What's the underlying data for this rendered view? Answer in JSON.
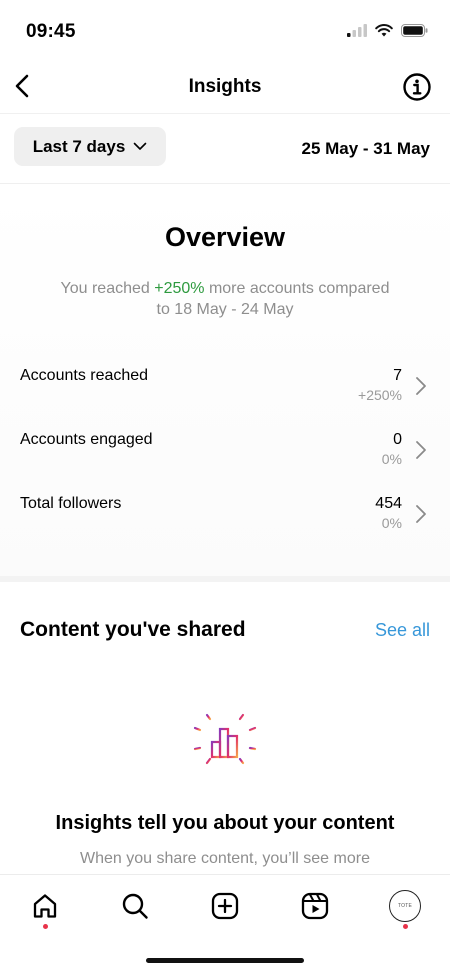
{
  "status_bar": {
    "time": "09:45"
  },
  "nav": {
    "title": "Insights"
  },
  "range": {
    "selector_label": "Last 7 days",
    "dates": "25 May - 31 May"
  },
  "overview": {
    "title": "Overview",
    "summary_prefix": "You reached ",
    "summary_highlight": "+250%",
    "summary_suffix": " more accounts compared",
    "summary_line2": "to 18 May - 24 May",
    "metrics": [
      {
        "label": "Accounts reached",
        "value": "7",
        "change": "+250%",
        "change_color": "#2e9a3f"
      },
      {
        "label": "Accounts engaged",
        "value": "0",
        "change": "0%",
        "change_color": "#9a9a9a"
      },
      {
        "label": "Total followers",
        "value": "454",
        "change": "0%",
        "change_color": "#9a9a9a"
      }
    ]
  },
  "content": {
    "title": "Content you've shared",
    "see_all": "See all",
    "empty_heading": "Insights tell you about your content",
    "empty_body": "When you share content, you’ll see more"
  },
  "tabbar": {
    "items": [
      "home-icon",
      "search-icon",
      "create-icon",
      "reels-icon",
      "profile-avatar"
    ],
    "avatar_text": "TOTE"
  },
  "colors": {
    "positive": "#2e9a3f",
    "link": "#3797d9",
    "notification": "#e8334a"
  }
}
